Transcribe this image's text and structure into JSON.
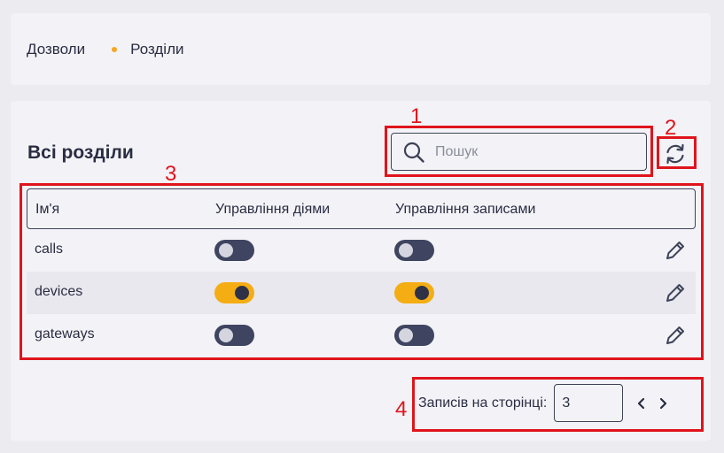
{
  "breadcrumb": {
    "parent": "Дозволи",
    "current": "Розділи"
  },
  "section": {
    "title": "Всі розділи"
  },
  "search": {
    "placeholder": "Пошук",
    "value": ""
  },
  "table": {
    "columns": [
      "Ім'я",
      "Управління діями",
      "Управління записами"
    ],
    "rows": [
      {
        "name": "calls",
        "actions_enabled": false,
        "records_enabled": false
      },
      {
        "name": "devices",
        "actions_enabled": true,
        "records_enabled": true
      },
      {
        "name": "gateways",
        "actions_enabled": false,
        "records_enabled": false
      }
    ]
  },
  "pagination": {
    "label": "Записів на сторінці:",
    "per_page": "3"
  },
  "annotations": [
    "1",
    "2",
    "3",
    "4"
  ],
  "icons": [
    "search-icon",
    "refresh-icon",
    "pencil-icon",
    "chevron-left-icon",
    "chevron-right-icon"
  ],
  "colors": {
    "toggle_on": "#f5ad14",
    "toggle_off": "#3f4560",
    "annotation": "#e0141c",
    "accent_dot": "#f5a623"
  }
}
